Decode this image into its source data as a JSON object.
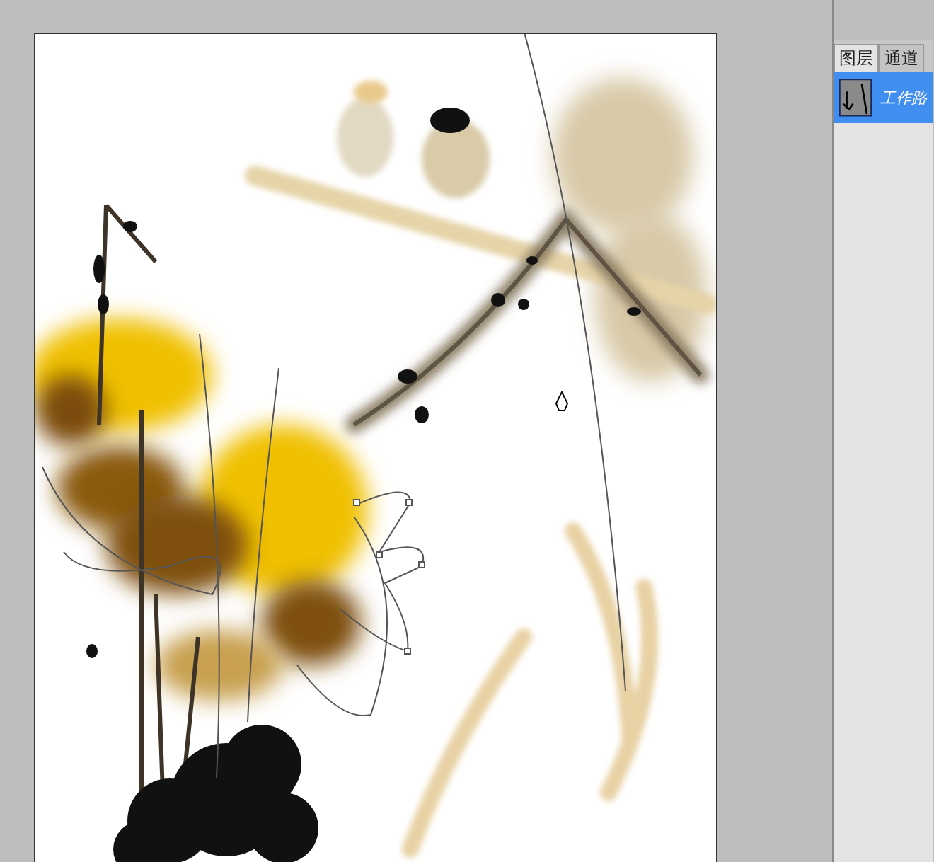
{
  "panel": {
    "tabs": [
      {
        "label": "图层",
        "selected": true
      },
      {
        "label": "通道",
        "selected": false
      }
    ],
    "paths": [
      {
        "name": "工作路",
        "selected": true
      }
    ]
  }
}
